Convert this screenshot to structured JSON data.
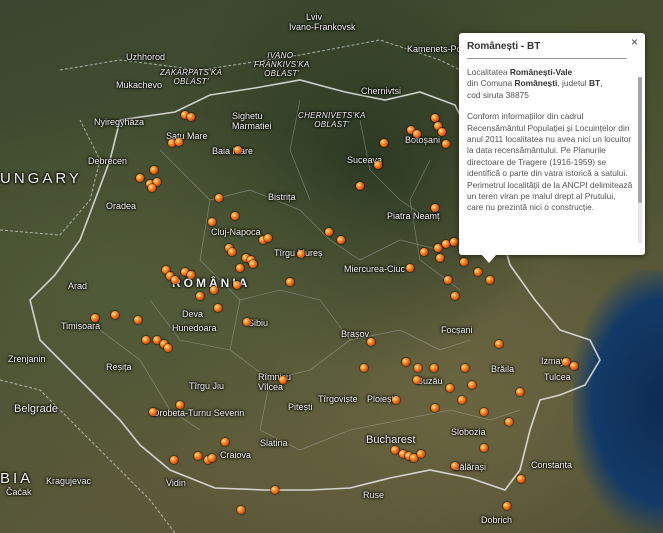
{
  "map": {
    "labels": {
      "country_hungary": "UNGARY",
      "country_romania": "ROMÂNIA",
      "country_serbia": "BIA",
      "zakarpats": "ZAKARPATS'KA\nOBLAST'",
      "ivano": "IVANO-\nFRANKIVS'KA\nOBLAST'",
      "chernivets": "CHERNIVETS'KA\nOBLAST'",
      "lviv": "Lviv",
      "ivano_frankovsk": "Ivano-Frankovsk",
      "uzhhorod": "Uzhhorod",
      "mukachevo": "Mukachevo",
      "nyiregyhaza": "Nyiregyháza",
      "sighetu": "Sighetu\nMarmatiei",
      "chernivtsi": "Chernivtsi",
      "kamenets": "Kamenets-Podol'skiy",
      "satu_mare": "Satu Mare",
      "baia_mare": "Baia Mare",
      "debrecen": "Debrecen",
      "botosani": "Botoșani",
      "suceava": "Suceava",
      "oradea": "Oradea",
      "bistrita": "Bistrița",
      "piatra_neamt": "Piatra Neamț",
      "cluj": "Cluj-Napoca",
      "tirgu_mures": "Tîrgu Mureș",
      "arad": "Arad",
      "miercurea": "Miercurea-Ciuc",
      "deva": "Deva",
      "hunedoara": "Hunedoara",
      "sibiu": "Sibiu",
      "timisoara": "Timișoara",
      "brasov": "Brașov",
      "focsani": "Focșani",
      "zrenjanin": "Zrenjanin",
      "resita": "Reșița",
      "tirgu_jiu": "Tîrgu Jiu",
      "rimnicu": "Rîmnicu\nVîlcea",
      "buzau": "Buzău",
      "braila": "Brăila",
      "izmail": "Izmay",
      "tulcea": "Tulcea",
      "belgrade": "Belgrade",
      "drobeta": "Drobeta-Turnu Severin",
      "pitesti": "Pitești",
      "tirgoviste": "Tîrgoviște",
      "ploiesti": "Ploiești",
      "slobozia": "Slobozia",
      "slatina": "Slatina",
      "craiova": "Craiova",
      "bucharest": "Bucharest",
      "kragujevac": "Kragujevac",
      "cacak": "Čačak",
      "vidin": "Vidin",
      "calarasi": "Călărași",
      "constanta": "Constanta",
      "ruse": "Ruse",
      "dobrich": "Dobrich"
    }
  },
  "popup": {
    "title": "Românești - BT",
    "close_glyph": "×",
    "line1_prefix": "Localitatea ",
    "locality": "Românești-Vale",
    "line2_prefix": "din Comuna ",
    "commune": "Românești",
    "line2_mid": ", judetul ",
    "county": "BT",
    "line2_suffix": ",",
    "siruta": "cod siruta 38875",
    "description": "Conform informațiilor din cadrul Recensământul Populației și Locuințelor din anul 2011 localitatea nu avea nici un locuitor la data recensământului. Pe Planurile directoare de Tragere (1916-1959) se identifică o parte din vatra istorică a satului. Perimetrul localității de la ANCPI delimitează un teren viran pe malul drept al Prutului, care nu prezintă nici o construcție."
  },
  "colors": {
    "marker": "#ff8a1c",
    "popup_bg": "#ffffff",
    "sea": "#133a66"
  }
}
